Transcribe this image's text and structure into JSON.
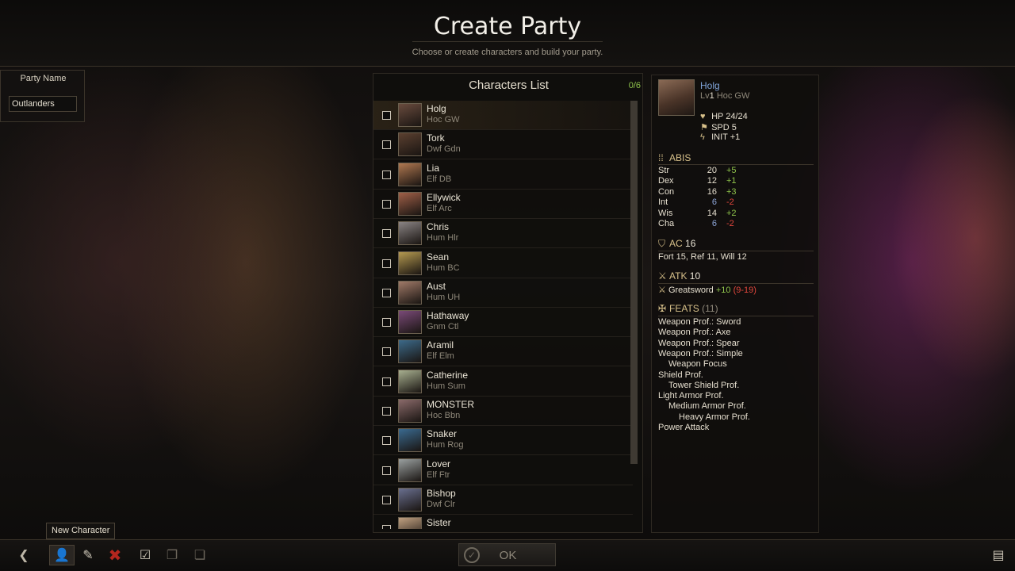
{
  "header": {
    "title": "Create Party",
    "subtitle": "Choose or create characters and build your party."
  },
  "party": {
    "label": "Party Name",
    "name_value": "Outlanders"
  },
  "characters_list": {
    "title": "Characters List",
    "count": "0/6",
    "items": [
      {
        "name": "Holg",
        "class": "Hoc GW",
        "portrait_color": "#6a4c3e",
        "selected": true
      },
      {
        "name": "Tork",
        "class": "Dwf Gdn",
        "portrait_color": "#5b4030"
      },
      {
        "name": "Lia",
        "class": "Elf DB",
        "portrait_color": "#b07850"
      },
      {
        "name": "Ellywick",
        "class": "Elf Arc",
        "portrait_color": "#a06048"
      },
      {
        "name": "Chris",
        "class": "Hum Hlr",
        "portrait_color": "#8a8484"
      },
      {
        "name": "Sean",
        "class": "Hum BC",
        "portrait_color": "#b59a50"
      },
      {
        "name": "Aust",
        "class": "Hum UH",
        "portrait_color": "#a07a68"
      },
      {
        "name": "Hathaway",
        "class": "Gnm Ctl",
        "portrait_color": "#7a4a78"
      },
      {
        "name": "Aramil",
        "class": "Elf Elm",
        "portrait_color": "#3c6a8a"
      },
      {
        "name": "Catherine",
        "class": "Hum Sum",
        "portrait_color": "#a8b090"
      },
      {
        "name": "MONSTER",
        "class": "Hoc Bbn",
        "portrait_color": "#8a6a6a"
      },
      {
        "name": "Snaker",
        "class": "Hum Rog",
        "portrait_color": "#3a6a90"
      },
      {
        "name": "Lover",
        "class": "Elf Ftr",
        "portrait_color": "#9aa0a0"
      },
      {
        "name": "Bishop",
        "class": "Dwf Clr",
        "portrait_color": "#6a7090"
      },
      {
        "name": "Sister",
        "class": "",
        "portrait_color": "#c0a080"
      }
    ]
  },
  "detail": {
    "name": "Holg",
    "level_prefix": "Lv",
    "level": "1",
    "race_class": "Hoc GW",
    "hp_label": "HP",
    "hp": "24/24",
    "spd_label": "SPD",
    "spd": "5",
    "init_label": "INIT",
    "init": "+1",
    "abis_title": "ABIS",
    "abilities": [
      {
        "name": "Str",
        "value": "20",
        "mod": "+5"
      },
      {
        "name": "Dex",
        "value": "12",
        "mod": "+1"
      },
      {
        "name": "Con",
        "value": "16",
        "mod": "+3"
      },
      {
        "name": "Int",
        "value": "6",
        "mod": "-2"
      },
      {
        "name": "Wis",
        "value": "14",
        "mod": "+2"
      },
      {
        "name": "Cha",
        "value": "6",
        "mod": "-2"
      }
    ],
    "ac_label": "AC",
    "ac": "16",
    "saves": {
      "fort_label": "Fort",
      "fort": "15",
      "ref_label": "Ref",
      "ref": "11",
      "will_label": "Will",
      "will": "12"
    },
    "atk_label": "ATK",
    "atk": "10",
    "weapon": {
      "name": "Greatsword",
      "bonus": "+10",
      "range": "(9-19)"
    },
    "feats_title": "FEATS",
    "feats_count": "(11)",
    "feats": [
      {
        "label": "Weapon Prof.: Sword",
        "indent": 0
      },
      {
        "label": "Weapon Prof.: Axe",
        "indent": 0
      },
      {
        "label": "Weapon Prof.: Spear",
        "indent": 0
      },
      {
        "label": "Weapon Prof.: Simple",
        "indent": 0
      },
      {
        "label": "Weapon Focus",
        "indent": 1
      },
      {
        "label": "Shield Prof.",
        "indent": 0
      },
      {
        "label": "Tower Shield Prof.",
        "indent": 1
      },
      {
        "label": "Light Armor Prof.",
        "indent": 0
      },
      {
        "label": "Medium Armor Prof.",
        "indent": 1
      },
      {
        "label": "Heavy Armor Prof.",
        "indent": 2
      },
      {
        "label": "Power Attack",
        "indent": 0
      }
    ]
  },
  "bottom": {
    "tooltip": "New Character",
    "ok_label": "OK"
  },
  "colors": {
    "accent_gold": "#d7c08a",
    "positive": "#8fc34b",
    "negative": "#e0463c",
    "name_blue": "#7fa3d6"
  }
}
